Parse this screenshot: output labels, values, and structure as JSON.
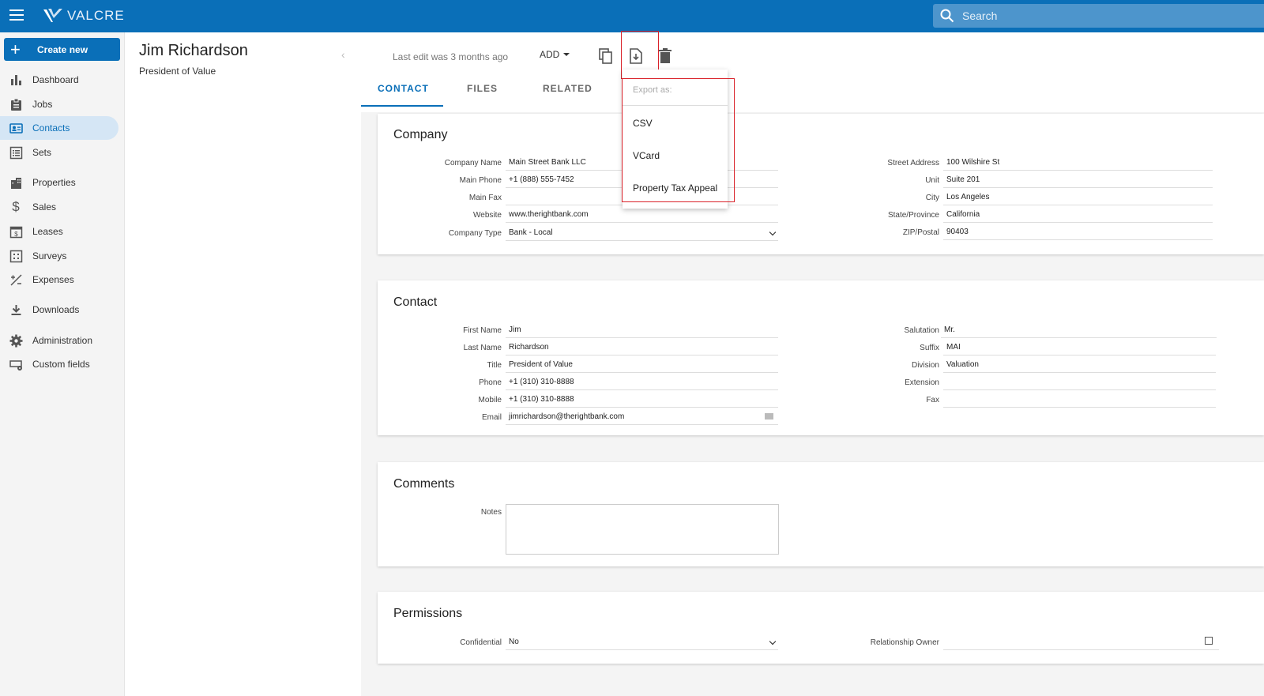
{
  "app": {
    "name": "VALCRE"
  },
  "search": {
    "placeholder": "Search"
  },
  "sidebar": {
    "create_label": "Create new",
    "items": [
      {
        "label": "Dashboard",
        "icon": "bar-chart-icon"
      },
      {
        "label": "Jobs",
        "icon": "clipboard-icon"
      },
      {
        "label": "Contacts",
        "icon": "contact-card-icon"
      },
      {
        "label": "Sets",
        "icon": "list-icon"
      },
      {
        "label": "Properties",
        "icon": "building-icon"
      },
      {
        "label": "Sales",
        "icon": "dollar-icon"
      },
      {
        "label": "Leases",
        "icon": "lease-calendar-icon"
      },
      {
        "label": "Surveys",
        "icon": "survey-grid-icon"
      },
      {
        "label": "Expenses",
        "icon": "plus-minus-icon"
      },
      {
        "label": "Downloads",
        "icon": "download-icon"
      },
      {
        "label": "Administration",
        "icon": "gear-icon"
      },
      {
        "label": "Custom fields",
        "icon": "custom-fields-icon"
      }
    ]
  },
  "record": {
    "name": "Jim Richardson",
    "subtitle": "President of Value"
  },
  "toolbar": {
    "last_edit": "Last edit was 3 months ago",
    "add_label": "ADD"
  },
  "tabs": [
    {
      "label": "CONTACT"
    },
    {
      "label": "FILES"
    },
    {
      "label": "RELATED"
    }
  ],
  "company": {
    "title": "Company",
    "left": [
      {
        "label": "Company Name",
        "value": "Main Street Bank LLC"
      },
      {
        "label": "Main Phone",
        "value": "+1 (888) 555-7452"
      },
      {
        "label": "Main Fax",
        "value": ""
      },
      {
        "label": "Website",
        "value": "www.therightbank.com"
      },
      {
        "label": "Company Type",
        "value": "Bank - Local"
      }
    ],
    "right": [
      {
        "label": "Street Address",
        "value": "100 Wilshire St"
      },
      {
        "label": "Unit",
        "value": "Suite 201"
      },
      {
        "label": "City",
        "value": "Los Angeles"
      },
      {
        "label": "State/Province",
        "value": "California"
      },
      {
        "label": "ZIP/Postal",
        "value": "90403"
      }
    ]
  },
  "contact": {
    "title": "Contact",
    "left": [
      {
        "label": "First Name",
        "value": "Jim"
      },
      {
        "label": "Last Name",
        "value": "Richardson"
      },
      {
        "label": "Title",
        "value": "President of Value"
      },
      {
        "label": "Phone",
        "value": "+1 (310) 310-8888"
      },
      {
        "label": "Mobile",
        "value": "+1 (310) 310-8888"
      },
      {
        "label": "Email",
        "value": "jimrichardson@therightbank.com"
      }
    ],
    "right": [
      {
        "label": "Salutation",
        "value": "Mr."
      },
      {
        "label": "Suffix",
        "value": "MAI"
      },
      {
        "label": "Division",
        "value": "Valuation"
      },
      {
        "label": "Extension",
        "value": ""
      },
      {
        "label": "Fax",
        "value": ""
      }
    ]
  },
  "comments": {
    "title": "Comments",
    "notes_label": "Notes",
    "notes_value": ""
  },
  "permissions": {
    "title": "Permissions",
    "confidential_label": "Confidential",
    "confidential_value": "No",
    "owner_label": "Relationship Owner",
    "owner_value": ""
  },
  "export_menu": {
    "header": "Export as:",
    "items": [
      {
        "label": "CSV"
      },
      {
        "label": "VCard"
      },
      {
        "label": "Property Tax Appeal"
      }
    ]
  }
}
